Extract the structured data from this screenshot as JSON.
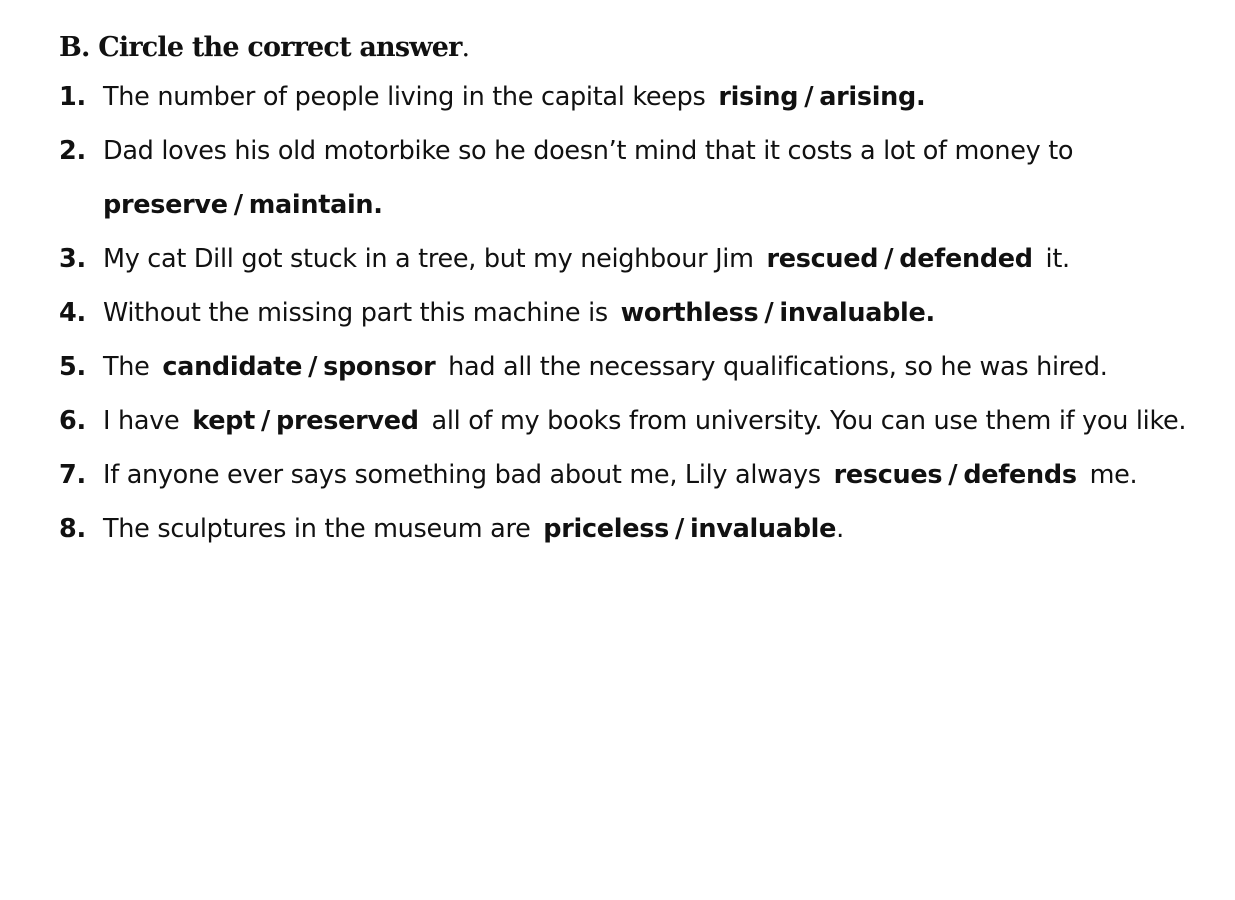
{
  "exercise": {
    "title": "B. Circle the correct answer",
    "title_end": "."
  },
  "items": [
    {
      "number": "1.",
      "before": "The number of people living in the capital keeps",
      "option_a": "rising",
      "separator": "/",
      "option_b": "arising.",
      "after": ""
    },
    {
      "number": "2.",
      "before": "Dad loves his old motorbike so he doesn’t mind that it costs a lot of money to",
      "option_a": "preserve",
      "separator": "/",
      "option_b": "maintain.",
      "after": ""
    },
    {
      "number": "3.",
      "before": "My cat Dill got stuck in a tree, but my neighbour Jim",
      "option_a": "rescued",
      "separator": "/",
      "option_b": "defended",
      "after": "it."
    },
    {
      "number": "4.",
      "before": "Without the missing part this machine is",
      "option_a": "worthless",
      "separator": "/",
      "option_b": "invaluable.",
      "after": ""
    },
    {
      "number": "5.",
      "before": "The",
      "option_a": "candidate",
      "separator": "/",
      "option_b": "sponsor",
      "after": "had all the necessary qualifications, so he was hired."
    },
    {
      "number": "6.",
      "before": "I have",
      "option_a": "kept",
      "separator": "/",
      "option_b": "preserved",
      "after": "all of my books from university. You can use them if you like."
    },
    {
      "number": "7.",
      "before": "If anyone ever says something bad about me, Lily always",
      "option_a": "rescues",
      "separator": "/",
      "option_b": "defends",
      "after": "me."
    },
    {
      "number": "8.",
      "before": "The sculptures in the museum are",
      "option_a": "priceless",
      "separator": "/",
      "option_b": "invaluable",
      "after": "."
    }
  ]
}
